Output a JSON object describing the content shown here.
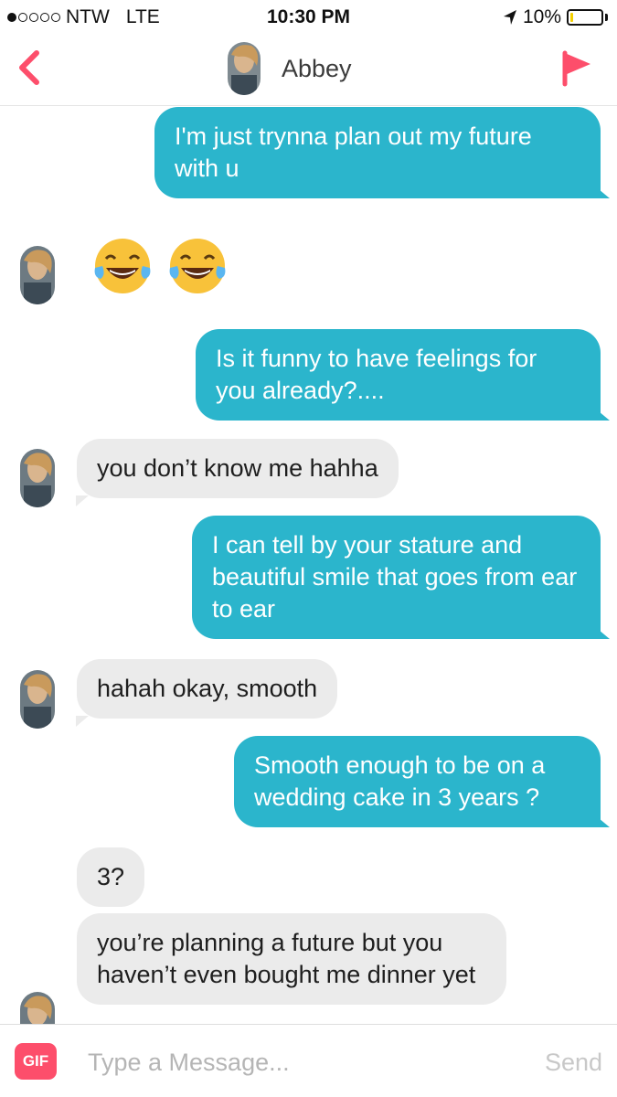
{
  "status_bar": {
    "carrier": "NTW",
    "network": "LTE",
    "time": "10:30 PM",
    "battery": "10%",
    "battery_level": 0.1,
    "signal_bars_filled": 1,
    "signal_bars_total": 5
  },
  "header": {
    "contact_name": "Abbey",
    "back_icon": "chevron-left-icon",
    "flag_icon": "flag-icon",
    "accent_color": "#fd4e6b"
  },
  "messages": [
    {
      "direction": "outgoing",
      "text": "I'm just trynna plan out my future with u"
    },
    {
      "direction": "incoming",
      "text": "😂😂"
    },
    {
      "direction": "outgoing",
      "text": "Is it funny to have feelings for you already?...."
    },
    {
      "direction": "incoming",
      "text": "you don’t know me hahha"
    },
    {
      "direction": "outgoing",
      "text": "I can tell by your stature and beautiful smile that goes from ear to ear"
    },
    {
      "direction": "incoming",
      "text": "hahah okay, smooth"
    },
    {
      "direction": "outgoing",
      "text": "Smooth enough to be on a wedding cake in 3 years ?"
    },
    {
      "direction": "incoming",
      "text": "3?"
    },
    {
      "direction": "incoming",
      "text": "you’re planning a future but you haven’t even bought me dinner yet"
    }
  ],
  "colors": {
    "outgoing_bubble": "#2bb5cc",
    "incoming_bubble": "#ebebeb"
  },
  "composer": {
    "gif_label": "GIF",
    "placeholder": "Type a Message...",
    "send_label": "Send"
  }
}
